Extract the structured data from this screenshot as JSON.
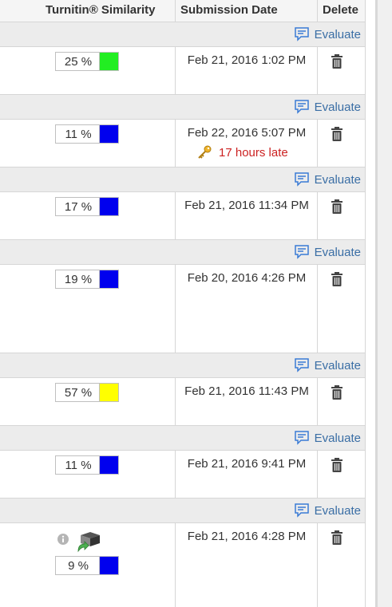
{
  "header": {
    "similarity": "Turnitin® Similarity",
    "submission_date": "Submission Date",
    "delete": "Delete"
  },
  "evaluate_label": "Evaluate",
  "rows": [
    {
      "similarity": "25 %",
      "swatch_color": "#22ee22",
      "date": "Feb 21, 2016 1:02 PM"
    },
    {
      "similarity": "11 %",
      "swatch_color": "#0000ee",
      "date": "Feb 22, 2016 5:07 PM",
      "late": "17 hours late"
    },
    {
      "similarity": "17 %",
      "swatch_color": "#0000ee",
      "date": "Feb 21, 2016 11:34 PM"
    },
    {
      "similarity": "19 %",
      "swatch_color": "#0000ee",
      "date": "Feb 20, 2016 4:26 PM"
    },
    {
      "similarity": "57 %",
      "swatch_color": "#ffff00",
      "date": "Feb 21, 2016 11:43 PM"
    },
    {
      "similarity": "11 %",
      "swatch_color": "#0000ee",
      "date": "Feb 21, 2016 9:41 PM"
    },
    {
      "similarity": "9 %",
      "swatch_color": "#0000ee",
      "date": "Feb 21, 2016 4:28 PM"
    }
  ]
}
